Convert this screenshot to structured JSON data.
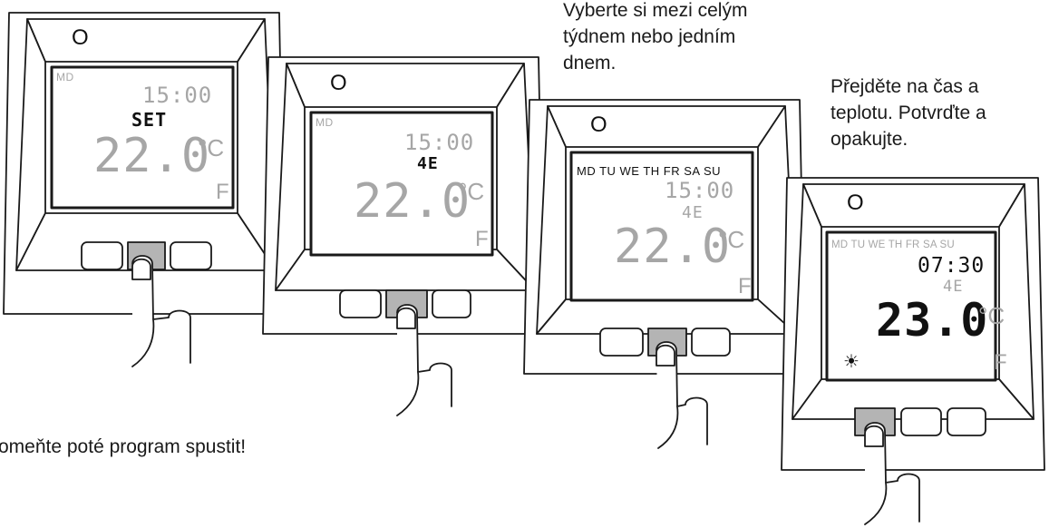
{
  "captions": {
    "select_week_or_day": "Vyberte si mezi celým\ntýdnem nebo jedním\ndnem.",
    "move_time_temp": "Přejděte na čas a\nteplotu. Potvrďte a\nopakujte.",
    "start_program": "omeňte poté program spustit!"
  },
  "thermostats": [
    {
      "led": "O",
      "days": "MD",
      "time": "15:00",
      "mode": "SET",
      "temp": "22.0",
      "unit": "°C",
      "flag": "F"
    },
    {
      "led": "O",
      "days": "MD",
      "time": "15:00",
      "mode": "4E",
      "temp": "22.0",
      "unit": "°C",
      "flag": "F"
    },
    {
      "led": "O",
      "days": "MD TU WE TH FR SA SU",
      "time": "15:00",
      "mode": "4E",
      "temp": "22.0",
      "unit": "°C",
      "flag": "F"
    },
    {
      "led": "O",
      "days": "MD TU WE TH FR SA SU",
      "time": "07:30",
      "mode": "4E",
      "temp": "23.0",
      "unit": "°C",
      "flag": "F",
      "sun_icon": "sun-icon"
    }
  ],
  "colors": {
    "lcd_dim": "#a6a6a6",
    "lcd_active": "#111111",
    "pressed_button": "#b4b4b4"
  }
}
